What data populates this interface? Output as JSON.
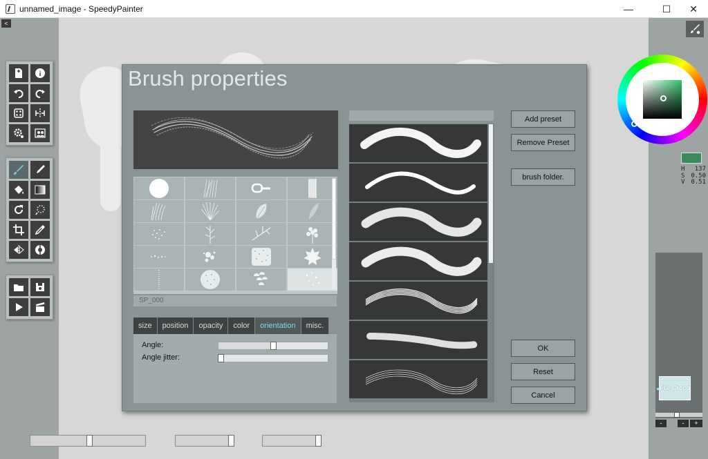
{
  "window": {
    "title": "unnamed_image - SpeedyPainter",
    "minimize": "—",
    "maximize": "☐",
    "close": "✕"
  },
  "left_panel": {
    "collapse_label": "<",
    "toolbox_1": [
      "new-document-icon",
      "info-icon",
      "undo-icon",
      "redo-icon",
      "dice-icon",
      "symmetry-icon",
      "settings-icon",
      "people-icon"
    ],
    "toolbox_2": [
      "brush-icon",
      "marker-icon",
      "fill-bucket-icon",
      "gradient-icon",
      "rotate-icon",
      "lasso-select-icon",
      "crop-icon",
      "eyedropper-icon",
      "flip-icon",
      "color-adjust-icon"
    ],
    "toolbox_3": [
      "open-folder-icon",
      "save-icon",
      "play-icon",
      "clapperboard-icon"
    ]
  },
  "bottom_sliders": {
    "brush_size": 0.51,
    "brush_opacity": 0.96,
    "zoom": 0.96
  },
  "color_picker": {
    "current_color": "#3d8a5c",
    "h_label": "H",
    "h_value": "137",
    "s_label": "S",
    "s_value": "0.50",
    "v_label": "V",
    "v_value": "0.51"
  },
  "layers": {
    "thumbnail_text": "File Croco",
    "remove_label": "-",
    "add_label": "+",
    "minus2_label": "-",
    "opacity": 0.5
  },
  "dialog": {
    "title": "Brush properties",
    "selected_tip_name": "SP_000",
    "tabs": [
      {
        "label": "size",
        "active": false
      },
      {
        "label": "position",
        "active": false
      },
      {
        "label": "opacity",
        "active": false
      },
      {
        "label": "color",
        "active": false
      },
      {
        "label": "orientation",
        "active": true
      },
      {
        "label": "misc.",
        "active": false
      }
    ],
    "properties": [
      {
        "label": "Angle:",
        "value": 0.5
      },
      {
        "label": "Angle jitter:",
        "value": 0.0
      }
    ],
    "buttons": {
      "add_preset": "Add preset",
      "remove_preset": "Remove Preset",
      "brush_folder": "brush folder.",
      "ok": "OK",
      "reset": "Reset",
      "cancel": "Cancel"
    },
    "brush_tips": [
      "circle",
      "grass-streaks",
      "chain-link",
      "rough-stroke",
      "hair-tuft",
      "feather-fan",
      "leaf",
      "thin-leaf",
      "speckle-cloud",
      "branch",
      "twig",
      "leafy-branch",
      "dots",
      "splatter",
      "stipple-square",
      "maple-leaf",
      "dotted-line",
      "speckle-circle",
      "scales",
      "stars"
    ],
    "presets": [
      "smooth-taper",
      "thin-ribbon",
      "rough-chalk",
      "dry-brush",
      "bristle",
      "spray-dots",
      "hair-lines"
    ]
  }
}
